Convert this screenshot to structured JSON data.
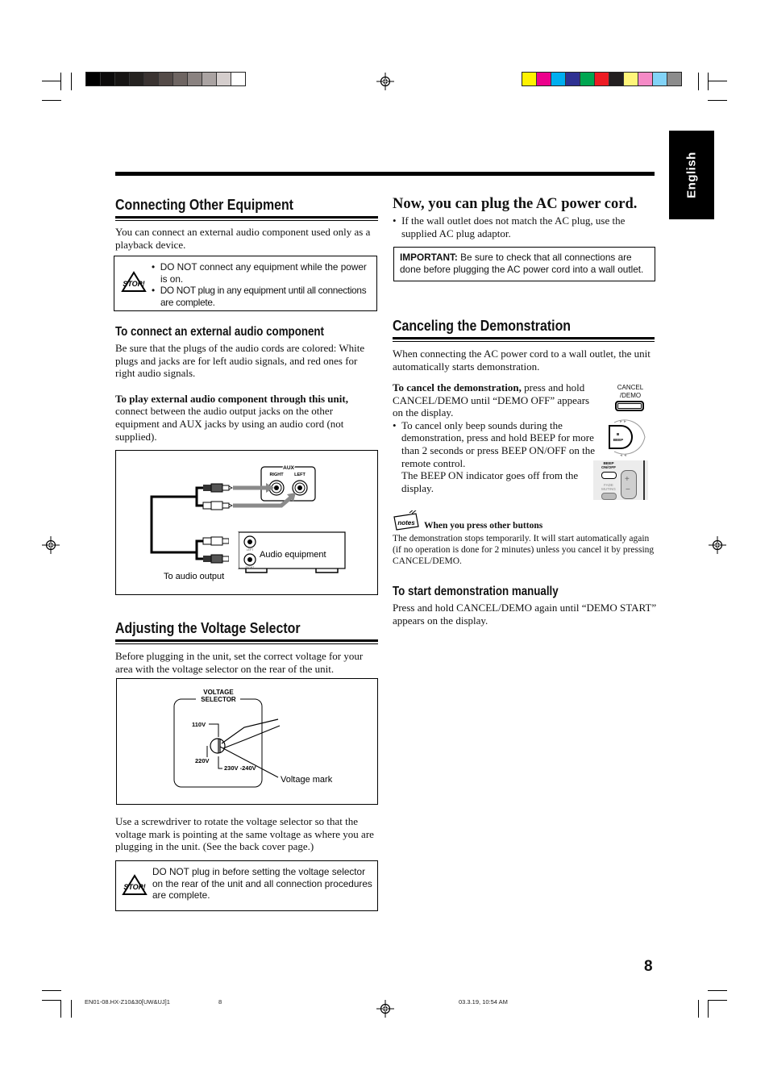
{
  "color_bars": {
    "grayscale": [
      "#000000",
      "#0b0a0a",
      "#161413",
      "#252220",
      "#3a3331",
      "#544b48",
      "#6e6562",
      "#8a8280",
      "#aaa3a2",
      "#d4cdcc",
      "#ffffff"
    ],
    "process": [
      "#fff100",
      "#ec008c",
      "#00aeef",
      "#2e3192",
      "#00a651",
      "#ed1c24",
      "#231f20",
      "#fff57a",
      "#f58ac6",
      "#82d3f7",
      "#8c8c8c"
    ]
  },
  "language_tab": "English",
  "left": {
    "connecting": {
      "title": "Connecting Other Equipment",
      "intro": "You can connect an external audio component used only as a playback device.",
      "stop_icon_label": "STOP!",
      "warnings": [
        "DO NOT connect any equipment while the power is on.",
        "DO NOT plug in any equipment until all connections are complete."
      ],
      "sub_title": "To connect an external audio component",
      "sub_text": "Be sure that the plugs of the audio cords are colored: White plugs and jacks are for left audio signals, and red ones for right audio signals.",
      "play_bold": "To play external audio component through this unit,",
      "play_text": " connect between the audio output jacks on the other equipment and AUX jacks by using an audio cord (not supplied).",
      "diagram": {
        "aux_label": "AUX",
        "right_label": "RIGHT",
        "left_label": "LEFT",
        "equipment_label": "Audio equipment",
        "equip_left_jack": "LEFT",
        "equip_right_jack": "RIGHT",
        "output_label": "To audio output"
      }
    },
    "voltage": {
      "title": "Adjusting the Voltage Selector",
      "intro": "Before plugging in the unit, set the correct voltage for your area with the voltage selector on the rear of the unit.",
      "diagram": {
        "selector_line1": "VOLTAGE",
        "selector_line2": "SELECTOR",
        "v110": "110V",
        "v220": "220V",
        "v230": "230V -240V",
        "mark_label": "Voltage mark"
      },
      "instructions": "Use a screwdriver to rotate the voltage selector so that the voltage mark is pointing at the same voltage as where you are plugging in the unit. (See the back cover page.)",
      "stop_icon_label": "STOP!",
      "warning": "DO NOT plug in before setting the voltage selector on the rear of the unit and all connection procedures are complete."
    }
  },
  "right": {
    "ac": {
      "title": "Now, you can plug the AC power cord.",
      "bullet": "If the wall outlet does not match the AC plug, use the supplied AC plug adaptor.",
      "important_bold": "IMPORTANT:",
      "important_text": " Be sure to check that all connections are done before plugging the AC power cord into a wall outlet."
    },
    "demo": {
      "title": "Canceling the Demonstration",
      "intro": "When connecting the AC power cord to a wall outlet, the unit automatically starts demonstration.",
      "cancel_bold": "To cancel the demonstration,",
      "cancel_text": " press and hold CANCEL/DEMO until “DEMO OFF” appears on the display.",
      "beep_bullet": "To cancel only beep sounds during the demonstration, press and hold BEEP for more than 2 seconds or press BEEP ON/OFF on the remote control.",
      "beep_note": "The BEEP ON indicator goes off from the display.",
      "cancel_button_line1": "CANCEL",
      "cancel_button_line2": "/DEMO",
      "beep_button_label": "BEEP",
      "remote_beep_line1": "BEEP",
      "remote_beep_line2": "ON/OFF",
      "remote_fade_line1": "FADE",
      "remote_fade_line2": "MUTING",
      "notes_icon_label": "notes",
      "notes_title": "When you press other buttons",
      "notes_text": "The demonstration stops temporarily. It will start automatically again (if no operation is done for 2 minutes) unless you cancel it by pressing CANCEL/DEMO.",
      "manual_title": "To start demonstration manually",
      "manual_text": "Press and hold CANCEL/DEMO again until “DEMO START” appears on the display."
    }
  },
  "page_number": "8",
  "footer": {
    "file": "EN01-08.HX-Z10&30[UW&UJ]1",
    "page": "8",
    "timestamp": "03.3.19, 10:54 AM"
  }
}
